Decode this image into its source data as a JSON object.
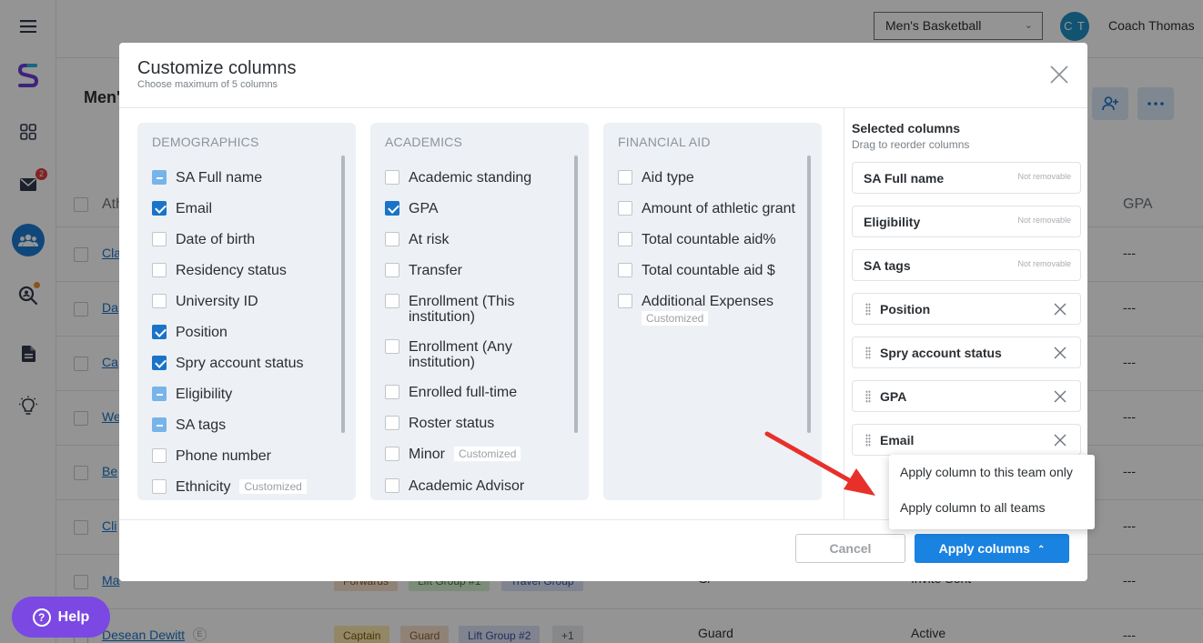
{
  "app": {
    "team_selector": "Men's Basketball",
    "user_initials": "C T",
    "user_name": "Coach Thomas",
    "page_title": "Men'",
    "notification_count": "2",
    "help_label": "Help",
    "help_glyph": "?"
  },
  "table": {
    "header_athlete": "Ath",
    "header_gpa": "GPA",
    "rows": [
      {
        "name": "Cla",
        "gpa": "---"
      },
      {
        "name": "Da",
        "gpa": "---"
      },
      {
        "name": "Ca",
        "gpa": "---"
      },
      {
        "name": "We",
        "gpa": "---"
      },
      {
        "name": "Be",
        "gpa": "---"
      },
      {
        "name": "Cli",
        "gpa": "---"
      },
      {
        "name": "Ma",
        "gpa": "---",
        "tags": [
          "Forwards",
          "Lift Group #1",
          "Travel Group"
        ],
        "position": "G/",
        "status": "Invite Sent"
      },
      {
        "name": "Desean Dewitt",
        "badge": "E",
        "gpa": "---",
        "tags": [
          "Captain",
          "Guard",
          "Lift Group #2",
          "+1"
        ],
        "position": "Guard",
        "status": "Active"
      }
    ]
  },
  "modal": {
    "title": "Customize columns",
    "subtitle": "Choose maximum of 5 columns",
    "groups": [
      {
        "heading": "DEMOGRAPHICS",
        "options": [
          {
            "label": "SA Full name",
            "state": "partial"
          },
          {
            "label": "Email",
            "state": "checked"
          },
          {
            "label": "Date of birth",
            "state": "unchecked"
          },
          {
            "label": "Residency status",
            "state": "unchecked"
          },
          {
            "label": "University ID",
            "state": "unchecked"
          },
          {
            "label": "Position",
            "state": "checked"
          },
          {
            "label": "Spry account status",
            "state": "checked"
          },
          {
            "label": "Eligibility",
            "state": "partial"
          },
          {
            "label": "SA tags",
            "state": "partial"
          },
          {
            "label": "Phone number",
            "state": "unchecked"
          },
          {
            "label": "Ethnicity",
            "state": "unchecked",
            "tag": "Customized"
          }
        ]
      },
      {
        "heading": "ACADEMICS",
        "options": [
          {
            "label": "Academic standing",
            "state": "unchecked"
          },
          {
            "label": "GPA",
            "state": "checked"
          },
          {
            "label": "At risk",
            "state": "unchecked"
          },
          {
            "label": "Transfer",
            "state": "unchecked"
          },
          {
            "label": "Enrollment (This institution)",
            "state": "unchecked"
          },
          {
            "label": "Enrollment (Any institution)",
            "state": "unchecked"
          },
          {
            "label": "Enrolled full-time",
            "state": "unchecked"
          },
          {
            "label": "Roster status",
            "state": "unchecked"
          },
          {
            "label": "Minor",
            "state": "unchecked",
            "tag": "Customized"
          },
          {
            "label": "Academic Advisor",
            "state": "unchecked"
          }
        ]
      },
      {
        "heading": "FINANCIAL AID",
        "options": [
          {
            "label": "Aid type",
            "state": "unchecked"
          },
          {
            "label": "Amount of athletic grant",
            "state": "unchecked"
          },
          {
            "label": "Total countable aid%",
            "state": "unchecked"
          },
          {
            "label": "Total countable aid $",
            "state": "unchecked"
          },
          {
            "label": "Additional Expenses",
            "state": "unchecked",
            "tag": "Customized"
          }
        ]
      }
    ],
    "selected": {
      "heading": "Selected columns",
      "subheading": "Drag to reorder columns",
      "not_removable_label": "Not removable",
      "items": [
        {
          "label": "SA Full name",
          "removable": false
        },
        {
          "label": "Eligibility",
          "removable": false
        },
        {
          "label": "SA tags",
          "removable": false
        },
        {
          "label": "Position",
          "removable": true
        },
        {
          "label": "Spry account status",
          "removable": true
        },
        {
          "label": "GPA",
          "removable": true
        },
        {
          "label": "Email",
          "removable": true
        }
      ]
    },
    "cancel_label": "Cancel",
    "apply_label": "Apply columns",
    "apply_menu": [
      "Apply column to this team only",
      "Apply column to all teams"
    ]
  },
  "colors": {
    "accent": "#1a82e0",
    "checked": "#1a73c8",
    "partial": "#76b4ea",
    "help": "#7b48e3",
    "annotation_arrow": "#e8302a"
  }
}
